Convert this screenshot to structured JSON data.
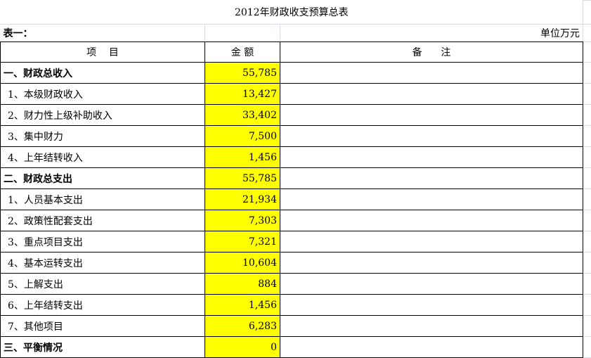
{
  "title": "2012年财政收支预算总表",
  "subheader": {
    "table_label": "表一：",
    "unit": "单位万元"
  },
  "headers": {
    "item": "项    目",
    "amount": "金 额",
    "remark": "备      注"
  },
  "rows": [
    {
      "item": "一、财政总收入",
      "amount": "55,785",
      "bold": true
    },
    {
      "item": "1、本级财政收入",
      "amount": "13,427",
      "bold": false
    },
    {
      "item": "2、财力性上级补助收入",
      "amount": "33,402",
      "bold": false
    },
    {
      "item": "3、集中财力",
      "amount": "7,500",
      "bold": false
    },
    {
      "item": "4、上年结转收入",
      "amount": "1,456",
      "bold": false
    },
    {
      "item": "二、财政总支出",
      "amount": "55,785",
      "bold": true
    },
    {
      "item": "1、人员基本支出",
      "amount": "21,934",
      "bold": false
    },
    {
      "item": "2、政策性配套支出",
      "amount": "7,303",
      "bold": false
    },
    {
      "item": "3、重点项目支出",
      "amount": "7,321",
      "bold": false
    },
    {
      "item": "4、基本运转支出",
      "amount": "10,604",
      "bold": false
    },
    {
      "item": "5、上解支出",
      "amount": "884",
      "bold": false
    },
    {
      "item": "6、上年结转支出",
      "amount": "1,456",
      "bold": false
    },
    {
      "item": "7、其他项目",
      "amount": "6,283",
      "bold": false
    },
    {
      "item": "三、平衡情况",
      "amount": "0",
      "bold": true
    }
  ],
  "colors": {
    "amount_fill": "#ffff00",
    "gridline": "#d6dbe4",
    "border": "#000000"
  }
}
